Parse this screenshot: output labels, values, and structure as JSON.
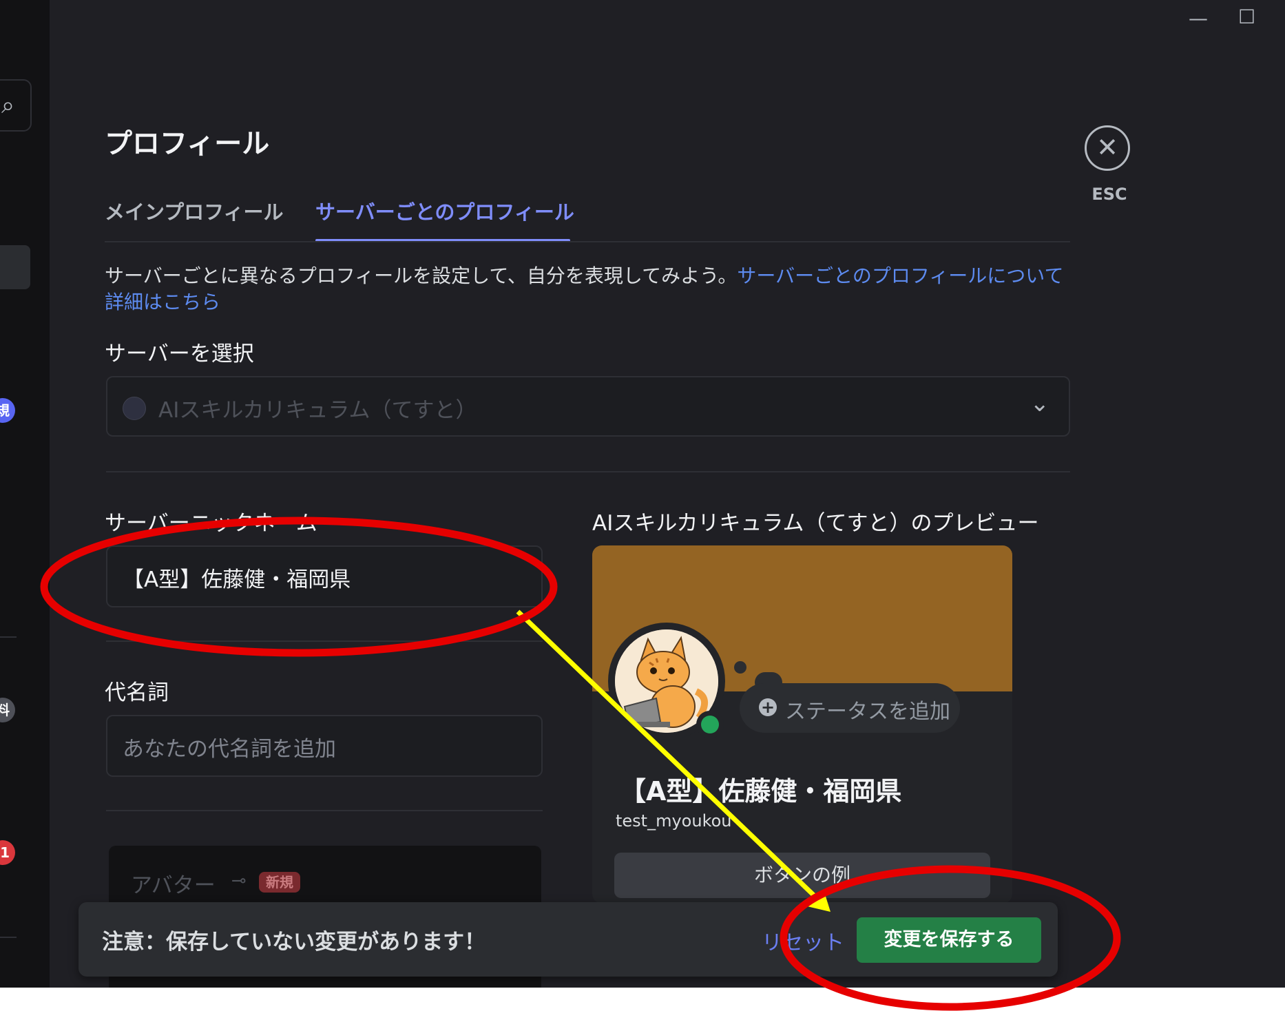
{
  "window": {
    "minimize_glyph": "—",
    "maximize_glyph": "☐"
  },
  "sidebar": {
    "search_icon": "search-icon",
    "badges": [
      "規",
      "料",
      "1"
    ]
  },
  "dialog": {
    "title": "プロフィール",
    "close_label": "ESC",
    "close_icon": "close-icon",
    "tabs": [
      {
        "label": "メインプロフィール",
        "active": false
      },
      {
        "label": "サーバーごとのプロフィール",
        "active": true
      }
    ],
    "description": "サーバーごとに異なるプロフィールを設定して、自分を表現してみよう。",
    "description_link": "サーバーごとのプロフィールについて詳細はこちら",
    "server_select": {
      "label": "サーバーを選択",
      "value": "AIスキルカリキュラム（てすと）"
    },
    "nickname": {
      "label": "サーバーニックネーム",
      "value": "【A型】佐藤健・福岡県"
    },
    "pronouns": {
      "label": "代名詞",
      "placeholder": "あなたの代名詞を追加"
    },
    "avatar": {
      "label": "アバター",
      "badge": "新規"
    }
  },
  "preview": {
    "title": "AIスキルカリキュラム（てすと）のプレビュー",
    "banner_color": "#946423",
    "status_prompt": "ステータスを追加",
    "display_name": "【A型】佐藤健・福岡県",
    "username": "test_myoukou",
    "example_button": "ボタンの例",
    "online_status_color": "#23a55a"
  },
  "notice": {
    "message": "注意：保存していない変更があります！",
    "reset_label": "リセット",
    "save_label": "変更を保存する",
    "save_color": "#248046"
  },
  "annotations": {
    "highlight_color": "#e60000",
    "arrow_color": "#ffff00"
  }
}
